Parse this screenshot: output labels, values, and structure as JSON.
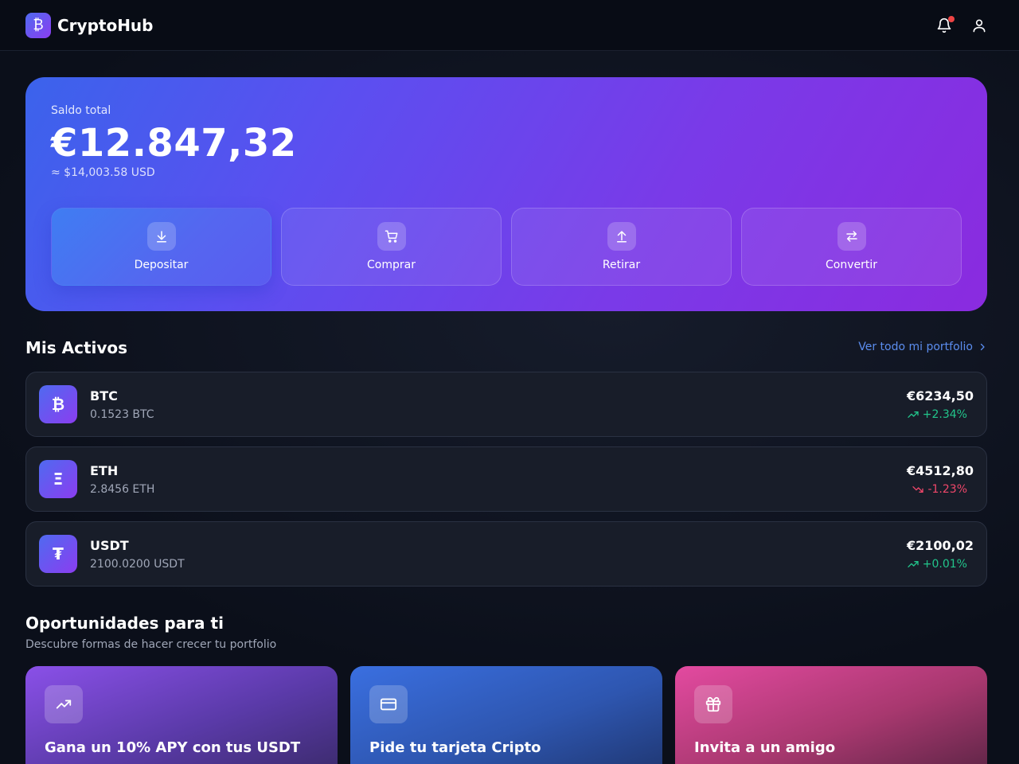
{
  "header": {
    "brand_icon": "₿",
    "brand_name": "CryptoHub",
    "icons": [
      "bell-icon",
      "user-icon"
    ]
  },
  "balance": {
    "label": "Saldo total",
    "amount": "€12.847,32",
    "usd": "≈ $14,003.58 USD",
    "actions": [
      {
        "label": "Depositar",
        "icon": "download-icon"
      },
      {
        "label": "Comprar",
        "icon": "cart-icon"
      },
      {
        "label": "Retirar",
        "icon": "upload-icon"
      },
      {
        "label": "Convertir",
        "icon": "swap-icon"
      }
    ]
  },
  "assets": {
    "title": "Mis Activos",
    "see_all": "Ver todo mi portfolio",
    "items": [
      {
        "icon": "₿",
        "symbol": "BTC",
        "amount": "0.1523 BTC",
        "value": "€6234,50",
        "change": "+2.34%",
        "trend": "up"
      },
      {
        "icon": "Ξ",
        "symbol": "ETH",
        "amount": "2.8456 ETH",
        "value": "€4512,80",
        "change": "-1.23%",
        "trend": "down"
      },
      {
        "icon": "₮",
        "symbol": "USDT",
        "amount": "2100.0200 USDT",
        "value": "€2100,02",
        "change": "+0.01%",
        "trend": "up"
      }
    ]
  },
  "opportunities": {
    "title": "Oportunidades para ti",
    "subtitle": "Descubre formas de hacer crecer tu portfolio",
    "items": [
      {
        "title": "Gana un 10% APY con tus USDT",
        "icon": "trending-up-icon"
      },
      {
        "title": "Pide tu tarjeta Cripto",
        "icon": "credit-card-icon"
      },
      {
        "title": "Invita a un amigo",
        "icon": "gift-icon"
      }
    ]
  },
  "colors": {
    "up": "#22c58b",
    "down": "#f0476a",
    "link": "#5b8def"
  }
}
